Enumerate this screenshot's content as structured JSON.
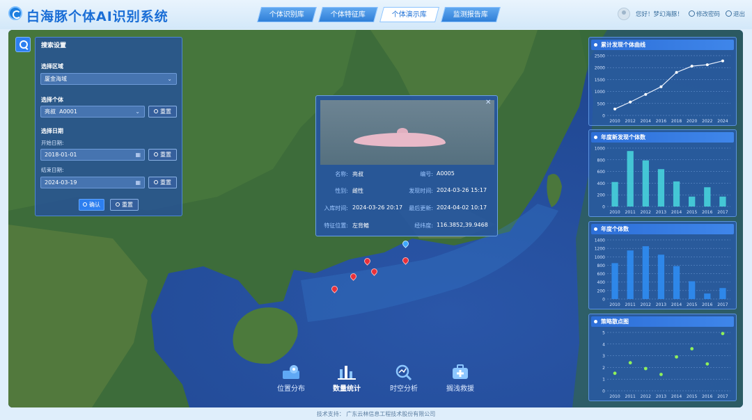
{
  "header": {
    "app_title": "白海豚个体AI识别系统",
    "tabs": [
      {
        "label": "个体识别库"
      },
      {
        "label": "个体特征库"
      },
      {
        "label": "个体演示库"
      },
      {
        "label": "监测报告库"
      }
    ],
    "active_tab": "个体演示库",
    "greeting": "您好！梦幻海豚！",
    "change_password": "修改密码",
    "logout": "退出"
  },
  "search": {
    "title": "搜索设置",
    "region_label": "选择区域",
    "region_value": "厦金海域",
    "individual_label": "选择个体",
    "individual_name": "亮叔",
    "individual_id": "A0001",
    "reset_label": "重置",
    "date_label": "选择日期",
    "start_label": "开始日期:",
    "start_value": "2018-01-01",
    "end_label": "结束日期:",
    "end_value": "2024-03-19",
    "confirm_label": "确认",
    "reset_all_label": "重置"
  },
  "popup": {
    "rows": [
      {
        "k1": "名称:",
        "v1": "亮叔",
        "k2": "编号:",
        "v2": "A0005"
      },
      {
        "k1": "性别:",
        "v1": "雌性",
        "k2": "发现时间:",
        "v2": "2024-03-26 15:17"
      },
      {
        "k1": "入库时间:",
        "v1": "2024-03-26 20:17",
        "k2": "最后更新:",
        "v2": "2024-04-02 10:17"
      },
      {
        "k1": "特征位置:",
        "v1": "左背鳍",
        "k2": "经纬度:",
        "v2": "116.3852,39.9468"
      }
    ]
  },
  "bottom_nav": [
    {
      "label": "位置分布",
      "icon": "location-icon"
    },
    {
      "label": "数量统计",
      "icon": "bar-chart-icon"
    },
    {
      "label": "时空分析",
      "icon": "analysis-icon"
    },
    {
      "label": "搁浅救援",
      "icon": "rescue-icon"
    }
  ],
  "bottom_nav_active": "数量统计",
  "footer": "技术支持：  广东云林信息工程技术股份有限公司",
  "chart_data": [
    {
      "type": "line",
      "title": "累计发现个体曲线",
      "x": [
        "2010",
        "2012",
        "2014",
        "2016",
        "2018",
        "2020",
        "2022",
        "2024"
      ],
      "values": [
        270,
        560,
        880,
        1200,
        1800,
        2060,
        2120,
        2280
      ],
      "ylim": [
        0,
        2500
      ],
      "yticks": [
        0,
        500,
        1000,
        1500,
        2000,
        2500
      ],
      "color": "#e6eefc"
    },
    {
      "type": "bar",
      "title": "年度新发现个体数",
      "categories": [
        "2010",
        "2011",
        "2012",
        "2013",
        "2014",
        "2015",
        "2016",
        "2017"
      ],
      "values": [
        420,
        950,
        790,
        640,
        430,
        170,
        330,
        170
      ],
      "ylim": [
        0,
        1000
      ],
      "yticks": [
        0,
        200,
        400,
        600,
        800,
        1000
      ],
      "color": "#47d2dc"
    },
    {
      "type": "bar",
      "title": "年度个体数",
      "categories": [
        "2010",
        "2011",
        "2012",
        "2013",
        "2014",
        "2015",
        "2016",
        "2017"
      ],
      "values": [
        850,
        1150,
        1250,
        1050,
        780,
        420,
        130,
        260
      ],
      "ylim": [
        0,
        1400
      ],
      "yticks": [
        0,
        200,
        400,
        600,
        800,
        1000,
        1200,
        1400
      ],
      "color": "#2f8cf2"
    },
    {
      "type": "scatter",
      "title": "策略散点图",
      "categories": [
        "2010",
        "2011",
        "2012",
        "2013",
        "2014",
        "2015",
        "2016",
        "2017"
      ],
      "values": [
        1.5,
        2.4,
        1.9,
        1.4,
        2.9,
        3.6,
        2.3,
        4.9
      ],
      "ylim": [
        0,
        5
      ],
      "yticks": [
        0,
        1,
        2,
        3,
        4,
        5
      ],
      "color": "#8ff05a"
    }
  ]
}
